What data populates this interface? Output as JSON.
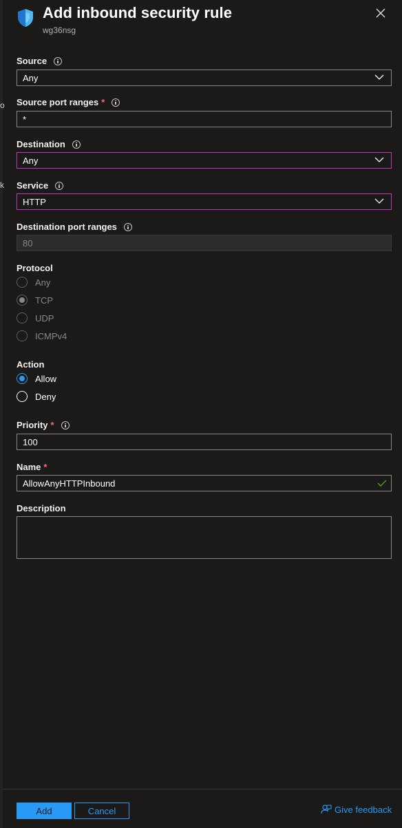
{
  "header": {
    "title": "Add inbound security rule",
    "subtitle": "wg36nsg",
    "brand_color": "#2899f5"
  },
  "left_fragments": [
    "o",
    "k"
  ],
  "source": {
    "label": "Source",
    "value": "Any"
  },
  "source_port": {
    "label": "Source port ranges",
    "required": "*",
    "value": "*"
  },
  "destination": {
    "label": "Destination",
    "value": "Any"
  },
  "service": {
    "label": "Service",
    "value": "HTTP"
  },
  "dest_port": {
    "label": "Destination port ranges",
    "value": "80"
  },
  "protocol": {
    "label": "Protocol",
    "options": [
      "Any",
      "TCP",
      "UDP",
      "ICMPv4"
    ],
    "selected": "TCP"
  },
  "action": {
    "label": "Action",
    "options": [
      "Allow",
      "Deny"
    ],
    "selected": "Allow"
  },
  "priority": {
    "label": "Priority",
    "required": "*",
    "value": "100"
  },
  "name": {
    "label": "Name",
    "required": "*",
    "value": "AllowAnyHTTPInbound"
  },
  "description": {
    "label": "Description",
    "value": ""
  },
  "footer": {
    "add_label": "Add",
    "cancel_label": "Cancel",
    "feedback_label": "Give feedback"
  }
}
